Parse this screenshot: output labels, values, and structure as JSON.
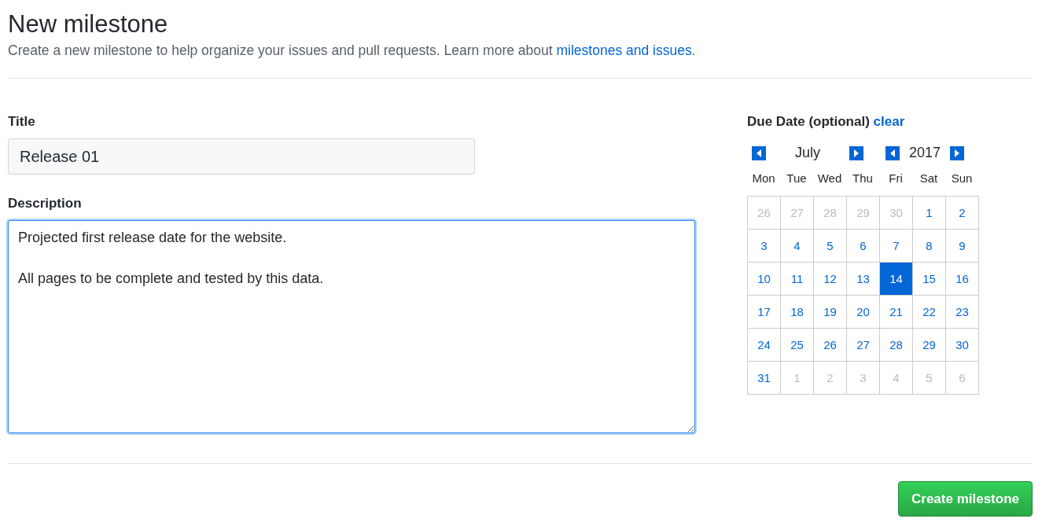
{
  "page": {
    "title": "New milestone",
    "subtitle": {
      "text": "Create a new milestone to help organize your issues and pull requests. Learn more about ",
      "link": "milestones and issues",
      "after": "."
    }
  },
  "form": {
    "title": {
      "label": "Title",
      "value": "Release 01"
    },
    "description": {
      "label": "Description",
      "value": "Projected first release date for the website.\n\nAll pages to be complete and tested by this data.",
      "focused": true
    }
  },
  "due_date": {
    "label": "Due Date (optional)",
    "clear": "clear",
    "month": "July",
    "year": "2017",
    "weekdays": [
      "Mon",
      "Tue",
      "Wed",
      "Thu",
      "Fri",
      "Sat",
      "Sun"
    ],
    "days": [
      {
        "label": "26",
        "in_month": false,
        "selected": false
      },
      {
        "label": "27",
        "in_month": false,
        "selected": false
      },
      {
        "label": "28",
        "in_month": false,
        "selected": false
      },
      {
        "label": "29",
        "in_month": false,
        "selected": false
      },
      {
        "label": "30",
        "in_month": false,
        "selected": false
      },
      {
        "label": "1",
        "in_month": true,
        "selected": false
      },
      {
        "label": "2",
        "in_month": true,
        "selected": false
      },
      {
        "label": "3",
        "in_month": true,
        "selected": false
      },
      {
        "label": "4",
        "in_month": true,
        "selected": false
      },
      {
        "label": "5",
        "in_month": true,
        "selected": false
      },
      {
        "label": "6",
        "in_month": true,
        "selected": false
      },
      {
        "label": "7",
        "in_month": true,
        "selected": false
      },
      {
        "label": "8",
        "in_month": true,
        "selected": false
      },
      {
        "label": "9",
        "in_month": true,
        "selected": false
      },
      {
        "label": "10",
        "in_month": true,
        "selected": false
      },
      {
        "label": "11",
        "in_month": true,
        "selected": false
      },
      {
        "label": "12",
        "in_month": true,
        "selected": false
      },
      {
        "label": "13",
        "in_month": true,
        "selected": false
      },
      {
        "label": "14",
        "in_month": true,
        "selected": true
      },
      {
        "label": "15",
        "in_month": true,
        "selected": false
      },
      {
        "label": "16",
        "in_month": true,
        "selected": false
      },
      {
        "label": "17",
        "in_month": true,
        "selected": false
      },
      {
        "label": "18",
        "in_month": true,
        "selected": false
      },
      {
        "label": "19",
        "in_month": true,
        "selected": false
      },
      {
        "label": "20",
        "in_month": true,
        "selected": false
      },
      {
        "label": "21",
        "in_month": true,
        "selected": false
      },
      {
        "label": "22",
        "in_month": true,
        "selected": false
      },
      {
        "label": "23",
        "in_month": true,
        "selected": false
      },
      {
        "label": "24",
        "in_month": true,
        "selected": false
      },
      {
        "label": "25",
        "in_month": true,
        "selected": false
      },
      {
        "label": "26",
        "in_month": true,
        "selected": false
      },
      {
        "label": "27",
        "in_month": true,
        "selected": false
      },
      {
        "label": "28",
        "in_month": true,
        "selected": false
      },
      {
        "label": "29",
        "in_month": true,
        "selected": false
      },
      {
        "label": "30",
        "in_month": true,
        "selected": false
      },
      {
        "label": "31",
        "in_month": true,
        "selected": false
      },
      {
        "label": "1",
        "in_month": false,
        "selected": false
      },
      {
        "label": "2",
        "in_month": false,
        "selected": false
      },
      {
        "label": "3",
        "in_month": false,
        "selected": false
      },
      {
        "label": "4",
        "in_month": false,
        "selected": false
      },
      {
        "label": "5",
        "in_month": false,
        "selected": false
      },
      {
        "label": "6",
        "in_month": false,
        "selected": false
      }
    ]
  },
  "submit": "Create milestone"
}
